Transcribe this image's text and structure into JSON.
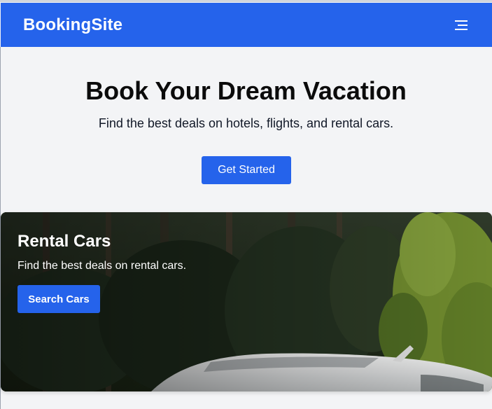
{
  "nav": {
    "brand": "BookingSite",
    "menu_icon": "hamburger-menu-icon"
  },
  "hero": {
    "title": "Book Your Dream Vacation",
    "subtitle": "Find the best deals on hotels, flights, and rental cars.",
    "cta_label": "Get Started"
  },
  "card": {
    "title": "Rental Cars",
    "subtitle": "Find the best deals on rental cars.",
    "button_label": "Search Cars",
    "image": "forest-road-with-white-car"
  },
  "colors": {
    "primary": "#2563eb",
    "background": "#f3f4f6",
    "text": "#0b0b0b"
  }
}
